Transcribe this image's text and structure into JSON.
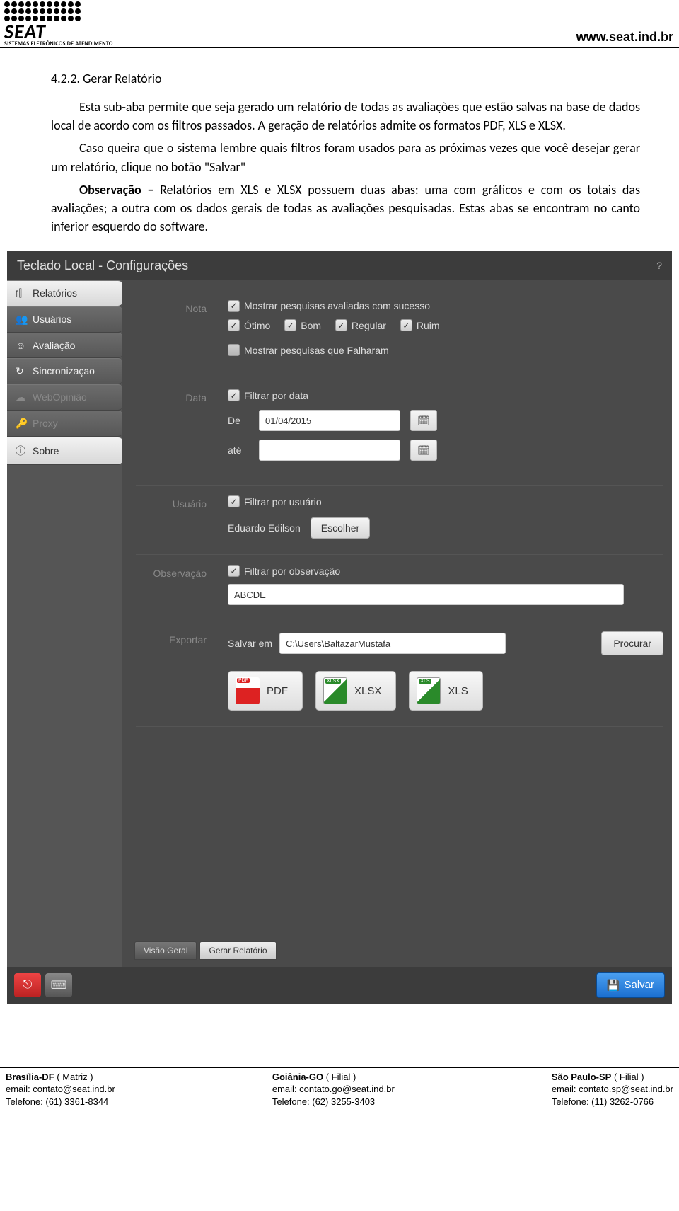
{
  "header": {
    "logo_text": "SEAT",
    "logo_sub": "SISTEMAS ELETRÔNICOS DE ATENDIMENTO",
    "site_url": "www.seat.ind.br"
  },
  "doc": {
    "section_number": "4.2.2. Gerar Relatório",
    "para1": "Esta sub-aba permite que seja gerado um relatório de todas as avaliações que estão salvas na base de dados local de acordo com os filtros passados. A geração de relatórios admite os formatos PDF, XLS e XLSX.",
    "para2": "Caso queira que o sistema lembre quais filtros foram usados para as próximas vezes que você desejar gerar um relatório, clique no botão \"Salvar\"",
    "obs_label": "Observação –",
    "obs_text": " Relatórios em XLS e XLSX possuem duas abas: uma com gráficos e com os totais das avaliações; a outra com os dados gerais de todas as avaliações pesquisadas. Estas abas se encontram no canto inferior esquerdo do software."
  },
  "app": {
    "title": "Teclado Local - Configurações",
    "help": "?",
    "sidebar": [
      {
        "label": "Relatórios",
        "icon": "📊",
        "active": true
      },
      {
        "label": "Usuários",
        "icon": "👥"
      },
      {
        "label": "Avaliação",
        "icon": "☺"
      },
      {
        "label": "Sincronizaçao",
        "icon": "↻"
      },
      {
        "label": "WebOpinião",
        "icon": "☁",
        "disabled": true
      },
      {
        "label": "Proxy",
        "icon": "🔑",
        "disabled": true
      },
      {
        "label": "Sobre",
        "icon": "ⓘ"
      }
    ],
    "nota": {
      "label": "Nota",
      "cb1": "Mostrar pesquisas avaliadas com sucesso",
      "opt1": "Ótimo",
      "opt2": "Bom",
      "opt3": "Regular",
      "opt4": "Ruim",
      "cb2": "Mostrar pesquisas que Falharam"
    },
    "data": {
      "label": "Data",
      "cb": "Filtrar por data",
      "de_label": "De",
      "de_value": "01/04/2015",
      "ate_label": "até",
      "ate_value": ""
    },
    "usuario": {
      "label": "Usuário",
      "cb": "Filtrar por usuário",
      "name": "Eduardo Edilson",
      "choose": "Escolher"
    },
    "observ": {
      "label": "Observação",
      "cb": "Filtrar por observação",
      "value": "ABCDE"
    },
    "export": {
      "label": "Exportar",
      "save_in": "Salvar em",
      "path": "C:\\Users\\BaltazarMustafa",
      "browse": "Procurar",
      "pdf": "PDF",
      "xlsx": "XLSX",
      "xls": "XLS"
    },
    "tabs": {
      "t1": "Visão Geral",
      "t2": "Gerar Relatório"
    },
    "save_btn": "Salvar"
  },
  "footer": {
    "c1_city": "Brasília-DF",
    "c1_role": "( Matriz )",
    "c1_email": "email: contato@seat.ind.br",
    "c1_tel": "Telefone: (61) 3361-8344",
    "c2_city": "Goiânia-GO",
    "c2_role": "( Filial )",
    "c2_email": "email: contato.go@seat.ind.br",
    "c2_tel": "Telefone: (62) 3255-3403",
    "c3_city": "São Paulo-SP",
    "c3_role": "( Filial )",
    "c3_email": "email: contato.sp@seat.ind.br",
    "c3_tel": "Telefone: (11) 3262-0766"
  }
}
